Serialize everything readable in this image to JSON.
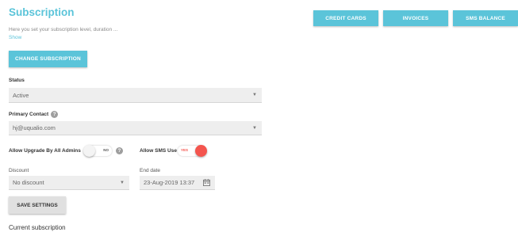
{
  "header": {
    "title": "Subscription",
    "description": "Here you set your subscription level, duration ...",
    "show_link": "Show"
  },
  "top_buttons": {
    "credit_cards": "CREDIT CARDS",
    "invoices": "INVOICES",
    "sms_balance": "SMS BALANCE"
  },
  "change_button": "CHANGE SUBSCRIPTION",
  "status": {
    "label": "Status",
    "value": "Active"
  },
  "primary_contact": {
    "label": "Primary Contact",
    "value": "hj@uqualio.com"
  },
  "allow_upgrade": {
    "label": "Allow Upgrade By All Admins",
    "state": "NO"
  },
  "allow_sms": {
    "label": "Allow SMS Use",
    "state": "YES"
  },
  "discount": {
    "label": "Discount",
    "value": "No discount"
  },
  "end_date": {
    "label": "End date",
    "value": "23-Aug-2019 13:37"
  },
  "save_button": "SAVE SETTINGS",
  "current_subscription": "Current subscription",
  "colors": {
    "accent": "#5bc4d9",
    "toggle_on": "#f4554e",
    "field_bg": "#eeeeee"
  },
  "icons": {
    "help": "help-circle-icon",
    "calendar": "calendar-icon",
    "caret": "caret-down-icon"
  }
}
